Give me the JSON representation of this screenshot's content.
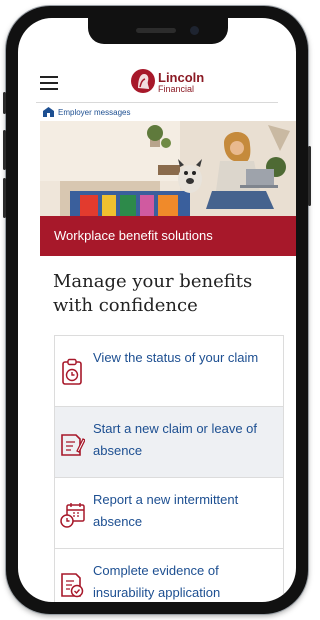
{
  "brand": {
    "name": "Lincoln",
    "sub": "Financial",
    "accent": "#a7182a",
    "link": "#1d4f91"
  },
  "header": {
    "menu_icon": "hamburger-icon",
    "employer_label": "Employer messages",
    "employer_icon": "building-icon"
  },
  "hero": {
    "banner": "Workplace benefit solutions"
  },
  "main": {
    "heading": "Manage your benefits with confidence",
    "actions": [
      {
        "label": "View the status of your claim",
        "icon": "clipboard-clock-icon"
      },
      {
        "label": "Start a new claim or leave of absence",
        "icon": "document-pen-icon"
      },
      {
        "label": "Report a new intermittent absence",
        "icon": "calendar-clock-icon"
      },
      {
        "label": "Complete evidence of insurability application",
        "icon": "form-check-icon"
      }
    ]
  }
}
